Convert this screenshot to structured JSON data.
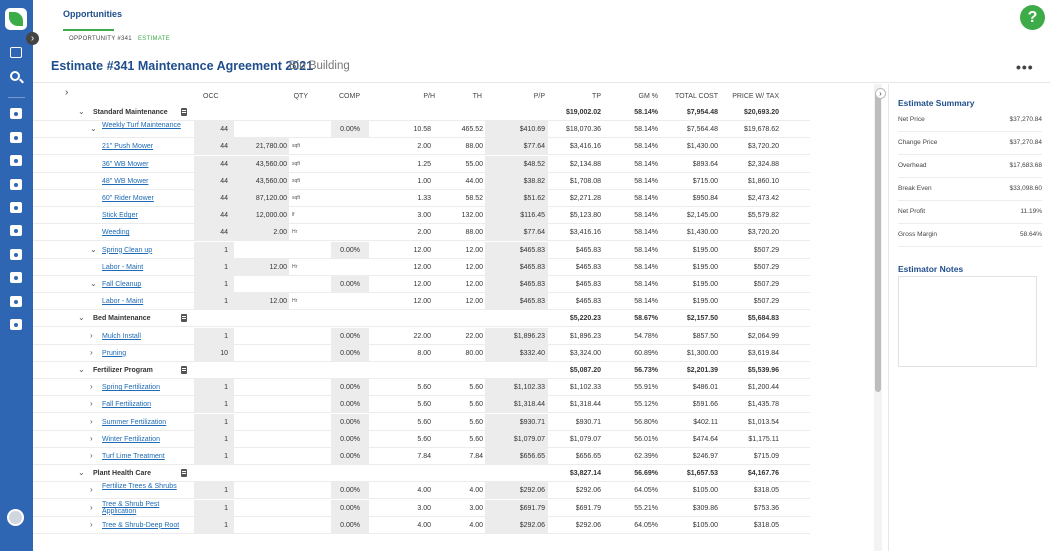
{
  "header": {
    "title": "Opportunities",
    "breadcrumb": [
      "OPPORTUNITY #341",
      "ESTIMATE"
    ],
    "help_label": "?",
    "estimate_title": "Estimate #341 Maintenance Agreement 2021",
    "estimate_subtitle": "Bio Building",
    "more_label": "•••"
  },
  "table": {
    "columns": [
      "OCC",
      "QTY",
      "COMP",
      "P/H",
      "TH",
      "P/P",
      "TP",
      "GM %",
      "TOTAL COST",
      "PRICE W/ TAX"
    ],
    "rows": [
      {
        "type": "group",
        "name": "Standard Maintenance",
        "tp": "$19,002.02",
        "gm": "58.14%",
        "cost": "$7,954.48",
        "price": "$20,693.20"
      },
      {
        "type": "item",
        "level": 1,
        "chev": "⌄",
        "name": "Weekly Turf Maintenance",
        "occ": "44",
        "qty": "",
        "unit": "",
        "comp": "0.00%",
        "ph": "10.58",
        "th": "465.52",
        "pp": "$410.69",
        "tp": "$18,070.36",
        "gm": "58.14%",
        "cost": "$7,564.48",
        "price": "$19,678.62"
      },
      {
        "type": "item",
        "level": 2,
        "name": "21\" Push Mower",
        "occ": "44",
        "qty": "21,780.00",
        "unit": "sqft",
        "comp": "",
        "ph": "2.00",
        "th": "88.00",
        "pp": "$77.64",
        "tp": "$3,416.16",
        "gm": "58.14%",
        "cost": "$1,430.00",
        "price": "$3,720.20"
      },
      {
        "type": "item",
        "level": 2,
        "name": "36\" WB Mower",
        "occ": "44",
        "qty": "43,560.00",
        "unit": "sqft",
        "comp": "",
        "ph": "1.25",
        "th": "55.00",
        "pp": "$48.52",
        "tp": "$2,134.88",
        "gm": "58.14%",
        "cost": "$893.64",
        "price": "$2,324.88"
      },
      {
        "type": "item",
        "level": 2,
        "name": "48\" WB Mower",
        "occ": "44",
        "qty": "43,560.00",
        "unit": "sqft",
        "comp": "",
        "ph": "1.00",
        "th": "44.00",
        "pp": "$38.82",
        "tp": "$1,708.08",
        "gm": "58.14%",
        "cost": "$715.00",
        "price": "$1,860.10"
      },
      {
        "type": "item",
        "level": 2,
        "name": "60\" Rider Mower",
        "occ": "44",
        "qty": "87,120.00",
        "unit": "sqft",
        "comp": "",
        "ph": "1.33",
        "th": "58.52",
        "pp": "$51.62",
        "tp": "$2,271.28",
        "gm": "58.14%",
        "cost": "$950.84",
        "price": "$2,473.42"
      },
      {
        "type": "item",
        "level": 2,
        "name": "Stick Edger",
        "occ": "44",
        "qty": "12,000.00",
        "unit": "lf",
        "comp": "",
        "ph": "3.00",
        "th": "132.00",
        "pp": "$116.45",
        "tp": "$5,123.80",
        "gm": "58.14%",
        "cost": "$2,145.00",
        "price": "$5,579.82"
      },
      {
        "type": "item",
        "level": 2,
        "name": "Weeding",
        "occ": "44",
        "qty": "2.00",
        "unit": "Hr",
        "comp": "",
        "ph": "2.00",
        "th": "88.00",
        "pp": "$77.64",
        "tp": "$3,416.16",
        "gm": "58.14%",
        "cost": "$1,430.00",
        "price": "$3,720.20"
      },
      {
        "type": "item",
        "level": 1,
        "chev": "⌄",
        "name": "Spring Clean up",
        "occ": "1",
        "qty": "",
        "unit": "",
        "comp": "0.00%",
        "ph": "12.00",
        "th": "12.00",
        "pp": "$465.83",
        "tp": "$465.83",
        "gm": "58.14%",
        "cost": "$195.00",
        "price": "$507.29"
      },
      {
        "type": "item",
        "level": 2,
        "name": "Labor - Maint",
        "occ": "1",
        "qty": "12.00",
        "unit": "Hr",
        "comp": "",
        "ph": "12.00",
        "th": "12.00",
        "pp": "$465.83",
        "tp": "$465.83",
        "gm": "58.14%",
        "cost": "$195.00",
        "price": "$507.29"
      },
      {
        "type": "item",
        "level": 1,
        "chev": "⌄",
        "name": "Fall Cleanup",
        "occ": "1",
        "qty": "",
        "unit": "",
        "comp": "0.00%",
        "ph": "12.00",
        "th": "12.00",
        "pp": "$465.83",
        "tp": "$465.83",
        "gm": "58.14%",
        "cost": "$195.00",
        "price": "$507.29"
      },
      {
        "type": "item",
        "level": 2,
        "name": "Labor - Maint",
        "occ": "1",
        "qty": "12.00",
        "unit": "Hr",
        "comp": "",
        "ph": "12.00",
        "th": "12.00",
        "pp": "$465.83",
        "tp": "$465.83",
        "gm": "58.14%",
        "cost": "$195.00",
        "price": "$507.29"
      },
      {
        "type": "group",
        "name": "Bed Maintenance",
        "tp": "$5,220.23",
        "gm": "58.67%",
        "cost": "$2,157.50",
        "price": "$5,684.83"
      },
      {
        "type": "item",
        "level": 1,
        "chev": "›",
        "name": "Mulch Install",
        "occ": "1",
        "qty": "",
        "unit": "",
        "comp": "0.00%",
        "ph": "22.00",
        "th": "22.00",
        "pp": "$1,896.23",
        "tp": "$1,896.23",
        "gm": "54.78%",
        "cost": "$857.50",
        "price": "$2,064.99"
      },
      {
        "type": "item",
        "level": 1,
        "chev": "›",
        "name": "Pruning",
        "occ": "10",
        "qty": "",
        "unit": "",
        "comp": "0.00%",
        "ph": "8.00",
        "th": "80.00",
        "pp": "$332.40",
        "tp": "$3,324.00",
        "gm": "60.89%",
        "cost": "$1,300.00",
        "price": "$3,619.84"
      },
      {
        "type": "group",
        "name": "Fertilizer Program",
        "tp": "$5,087.20",
        "gm": "56.73%",
        "cost": "$2,201.39",
        "price": "$5,539.96"
      },
      {
        "type": "item",
        "level": 1,
        "chev": "›",
        "name": "Spring Fertilization",
        "occ": "1",
        "qty": "",
        "unit": "",
        "comp": "0.00%",
        "ph": "5.60",
        "th": "5.60",
        "pp": "$1,102.33",
        "tp": "$1,102.33",
        "gm": "55.91%",
        "cost": "$486.01",
        "price": "$1,200.44"
      },
      {
        "type": "item",
        "level": 1,
        "chev": "›",
        "name": "Fall Fertilization",
        "occ": "1",
        "qty": "",
        "unit": "",
        "comp": "0.00%",
        "ph": "5.60",
        "th": "5.60",
        "pp": "$1,318.44",
        "tp": "$1,318.44",
        "gm": "55.12%",
        "cost": "$591.66",
        "price": "$1,435.78"
      },
      {
        "type": "item",
        "level": 1,
        "chev": "›",
        "name": "Summer Fertilization",
        "occ": "1",
        "qty": "",
        "unit": "",
        "comp": "0.00%",
        "ph": "5.60",
        "th": "5.60",
        "pp": "$930.71",
        "tp": "$930.71",
        "gm": "56.80%",
        "cost": "$402.11",
        "price": "$1,013.54"
      },
      {
        "type": "item",
        "level": 1,
        "chev": "›",
        "name": "Winter Fertilization",
        "occ": "1",
        "qty": "",
        "unit": "",
        "comp": "0.00%",
        "ph": "5.60",
        "th": "5.60",
        "pp": "$1,079.07",
        "tp": "$1,079.07",
        "gm": "56.01%",
        "cost": "$474.64",
        "price": "$1,175.11"
      },
      {
        "type": "item",
        "level": 1,
        "chev": "›",
        "name": "Turf Lime Treatment",
        "occ": "1",
        "qty": "",
        "unit": "",
        "comp": "0.00%",
        "ph": "7.84",
        "th": "7.84",
        "pp": "$656.65",
        "tp": "$656.65",
        "gm": "62.39%",
        "cost": "$246.97",
        "price": "$715.09"
      },
      {
        "type": "group",
        "name": "Plant Health Care",
        "tp": "$3,827.14",
        "gm": "56.69%",
        "cost": "$1,657.53",
        "price": "$4,167.76"
      },
      {
        "type": "item",
        "level": 1,
        "chev": "›",
        "name": "Fertilize Trees & Shrubs",
        "occ": "1",
        "qty": "",
        "unit": "",
        "comp": "0.00%",
        "ph": "4.00",
        "th": "4.00",
        "pp": "$292.06",
        "tp": "$292.06",
        "gm": "64.05%",
        "cost": "$105.00",
        "price": "$318.05"
      },
      {
        "type": "item",
        "level": 1,
        "chev": "›",
        "name": "Tree & Shrub Pest Application",
        "occ": "1",
        "qty": "",
        "unit": "",
        "comp": "0.00%",
        "ph": "3.00",
        "th": "3.00",
        "pp": "$691.79",
        "tp": "$691.79",
        "gm": "55.21%",
        "cost": "$309.86",
        "price": "$753.36"
      },
      {
        "type": "item",
        "level": 1,
        "chev": "›",
        "name": "Tree & Shrub-Deep Root",
        "occ": "1",
        "qty": "",
        "unit": "",
        "comp": "0.00%",
        "ph": "4.00",
        "th": "4.00",
        "pp": "$292.06",
        "tp": "$292.06",
        "gm": "64.05%",
        "cost": "$105.00",
        "price": "$318.05"
      }
    ]
  },
  "summary": {
    "title": "Estimate Summary",
    "items": [
      {
        "label": "Net Price",
        "value": "$37,270.84"
      },
      {
        "label": "Change Price",
        "value": "$37,270.84"
      },
      {
        "label": "Overhead",
        "value": "$17,683.68"
      },
      {
        "label": "Break Even",
        "value": "$33,098.60"
      },
      {
        "label": "Net Profit",
        "value": "11.19%"
      },
      {
        "label": "Gross Margin",
        "value": "58.64%"
      }
    ]
  },
  "notes": {
    "title": "Estimator Notes"
  },
  "colors": {
    "sidebar": "#2f66b3",
    "accent": "#3cab48",
    "title": "#1f4e8c",
    "link": "#1f6bb5"
  }
}
